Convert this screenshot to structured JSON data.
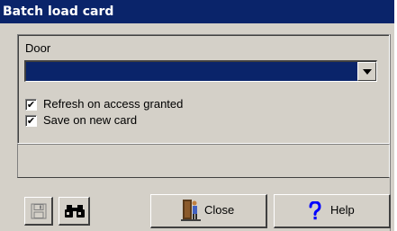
{
  "window": {
    "title": "Batch load card"
  },
  "form": {
    "door_label": "Door",
    "door_value": "",
    "refresh_label": "Refresh on access granted",
    "refresh_checked": true,
    "save_label": "Save on new card",
    "save_checked": true,
    "check_glyph": "✔"
  },
  "toolbar": {
    "save_icon": "save-disk-icon",
    "find_icon": "binoculars-icon",
    "close_label": "Close",
    "close_icon": "door-exit-icon",
    "help_label": "Help",
    "help_icon": "question-mark-icon"
  },
  "colors": {
    "title_bg": "#0a246a",
    "window_bg": "#d4d0c8",
    "selection": "#0a246a",
    "help_blue": "#0000ff"
  }
}
